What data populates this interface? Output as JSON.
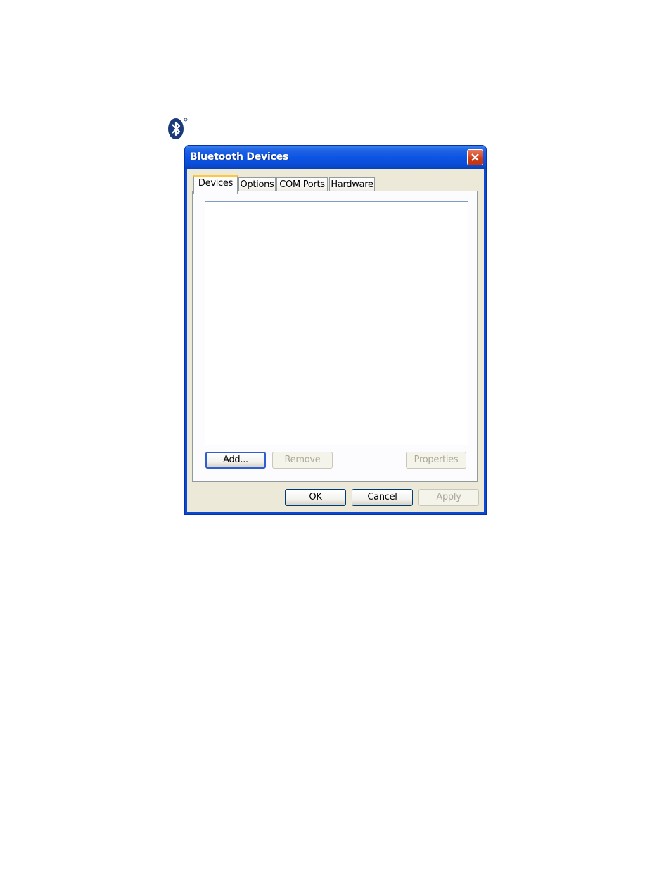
{
  "window": {
    "title": "Bluetooth Devices"
  },
  "tabs": [
    {
      "label": "Devices",
      "active": true
    },
    {
      "label": "Options",
      "active": false
    },
    {
      "label": "COM Ports",
      "active": false
    },
    {
      "label": "Hardware",
      "active": false
    }
  ],
  "devices_panel": {
    "add_label": "Add...",
    "remove_label": "Remove",
    "properties_label": "Properties"
  },
  "footer": {
    "ok_label": "OK",
    "cancel_label": "Cancel",
    "apply_label": "Apply"
  },
  "icons": {
    "logo": "bluetooth-icon",
    "close": "close-icon"
  },
  "colors": {
    "titlebar": "#0c55e4",
    "client": "#ece9d8",
    "active_tab_accent": "#ffc83c",
    "close_button": "#cc3b16",
    "bluetooth_blue": "#1b3a7a"
  }
}
